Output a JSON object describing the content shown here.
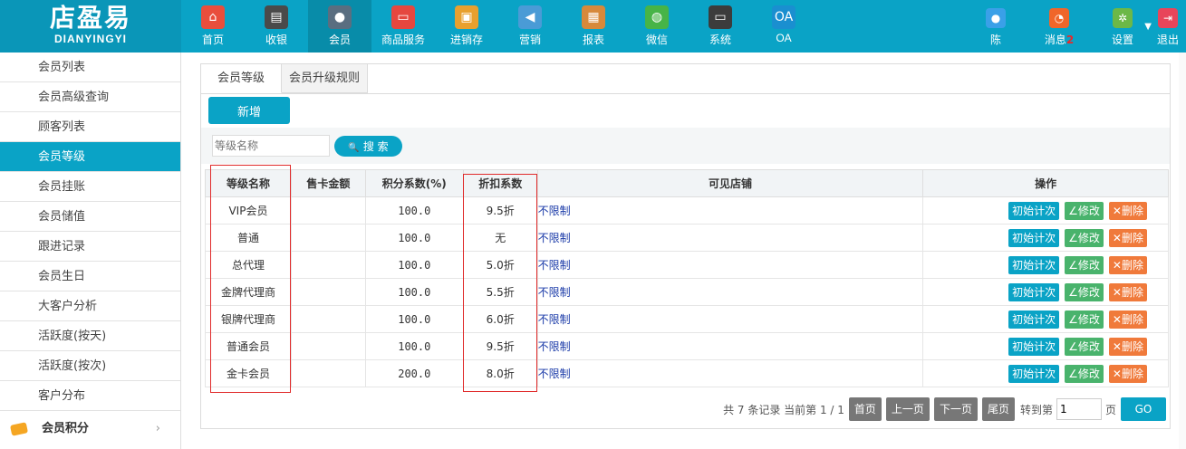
{
  "logo": {
    "cn": "店盈易",
    "en": "DIANYINGYI"
  },
  "nav": [
    {
      "label": "首页",
      "icon": "home-icon",
      "color": "#e94e3c",
      "glyph": "⌂"
    },
    {
      "label": "收银",
      "icon": "cash-register-icon",
      "color": "#4a4a4a",
      "glyph": "▤"
    },
    {
      "label": "会员",
      "icon": "member-icon",
      "color": "#5a6e80",
      "glyph": "●",
      "active": true
    },
    {
      "label": "商品服务",
      "icon": "goods-icon",
      "color": "#e5473f",
      "glyph": "▭"
    },
    {
      "label": "进销存",
      "icon": "inventory-icon",
      "color": "#e8a02e",
      "glyph": "▣"
    },
    {
      "label": "营销",
      "icon": "marketing-icon",
      "color": "#4a9bd6",
      "glyph": "◀"
    },
    {
      "label": "报表",
      "icon": "report-icon",
      "color": "#d7893a",
      "glyph": "▦"
    },
    {
      "label": "微信",
      "icon": "wechat-icon",
      "color": "#47b447",
      "glyph": "◍"
    },
    {
      "label": "系统",
      "icon": "system-icon",
      "color": "#3c3c3c",
      "glyph": "▭"
    },
    {
      "label": "OA",
      "icon": "oa-icon",
      "color": "#1a8fd0",
      "glyph": "OA"
    }
  ],
  "right_nav": [
    {
      "label": "陈",
      "icon": "user-icon",
      "color": "#3aa0e8",
      "glyph": "●"
    },
    {
      "label": "消息",
      "badge": "2",
      "icon": "bell-icon",
      "color": "#f0662a",
      "glyph": "◔"
    },
    {
      "label": "设置",
      "icon": "gear-icon",
      "color": "#6cb847",
      "glyph": "✲"
    },
    {
      "label": "退出",
      "icon": "logout-icon",
      "color": "#e8455a",
      "glyph": "⇥"
    }
  ],
  "sidebar": {
    "items": [
      {
        "label": "会员列表"
      },
      {
        "label": "会员高级查询"
      },
      {
        "label": "顾客列表"
      },
      {
        "label": "会员等级",
        "active": true
      },
      {
        "label": "会员挂账"
      },
      {
        "label": "会员储值"
      },
      {
        "label": "跟进记录"
      },
      {
        "label": "会员生日"
      },
      {
        "label": "大客户分析"
      },
      {
        "label": "活跃度(按天)"
      },
      {
        "label": "活跃度(按次)"
      },
      {
        "label": "客户分布"
      }
    ],
    "group": {
      "label": "会员积分",
      "chevron": "›"
    }
  },
  "tabs": [
    {
      "label": "会员等级",
      "active": true
    },
    {
      "label": "会员升级规则"
    }
  ],
  "toolbar": {
    "add_label": "新增"
  },
  "search": {
    "placeholder": "等级名称",
    "button_label": "搜 索",
    "button_icon": "🔍"
  },
  "table": {
    "headers": [
      "等级名称",
      "售卡金额",
      "积分系数(%)",
      "折扣系数",
      "可见店铺",
      "操作"
    ],
    "rows": [
      {
        "name": "VIP会员",
        "card_amount": "",
        "points": "100.0",
        "discount": "9.5折",
        "store": "不限制"
      },
      {
        "name": "普通",
        "card_amount": "",
        "points": "100.0",
        "discount": "无",
        "store": "不限制"
      },
      {
        "name": "总代理",
        "card_amount": "",
        "points": "100.0",
        "discount": "5.0折",
        "store": "不限制"
      },
      {
        "name": "金牌代理商",
        "card_amount": "",
        "points": "100.0",
        "discount": "5.5折",
        "store": "不限制"
      },
      {
        "name": "银牌代理商",
        "card_amount": "",
        "points": "100.0",
        "discount": "6.0折",
        "store": "不限制"
      },
      {
        "name": "普通会员",
        "card_amount": "",
        "points": "100.0",
        "discount": "9.5折",
        "store": "不限制"
      },
      {
        "name": "金卡会员",
        "card_amount": "",
        "points": "200.0",
        "discount": "8.0折",
        "store": "不限制"
      }
    ],
    "actions": {
      "init": "初始计次",
      "edit": "修改",
      "delete": "删除",
      "edit_icon": "∠",
      "delete_icon": "✕"
    }
  },
  "pager": {
    "summary": "共 7 条记录 当前第 1 / 1",
    "first": "首页",
    "prev": "上一页",
    "next": "下一页",
    "last": "尾页",
    "goto_label": "转到第",
    "goto_value": "1",
    "page_suffix": "页",
    "go": "GO"
  }
}
